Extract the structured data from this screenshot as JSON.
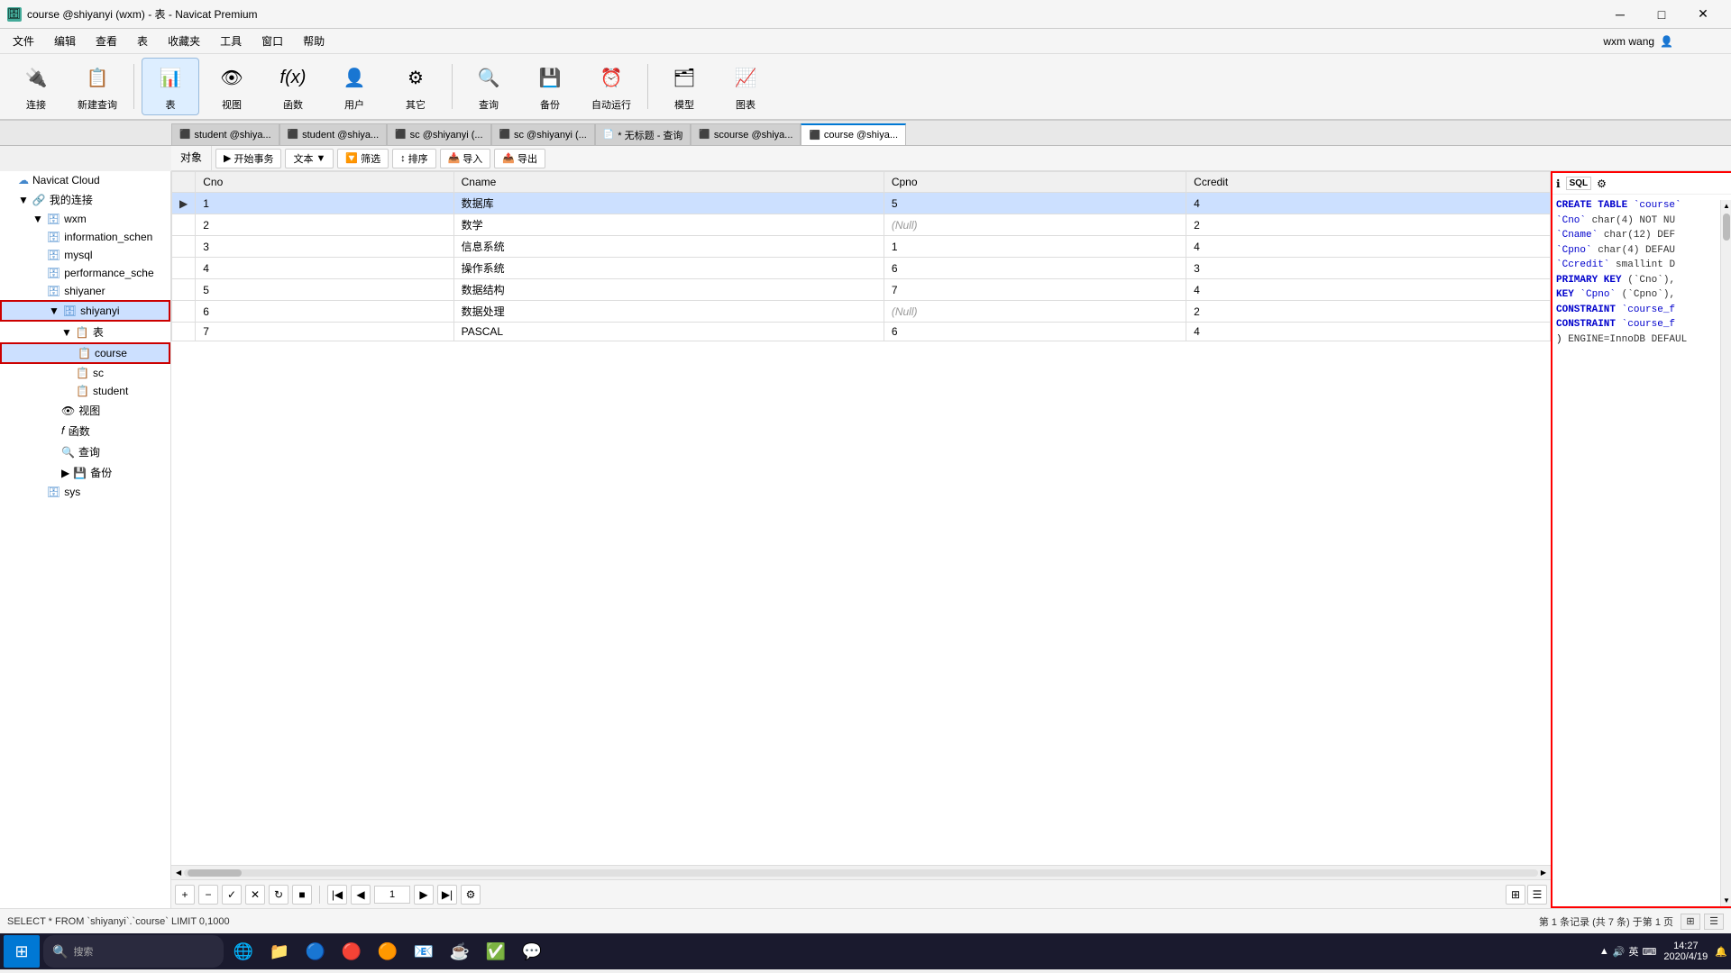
{
  "window": {
    "title": "course @shiyanyi (wxm) - 表 - Navicat Premium",
    "user": "wxm wang",
    "controls": {
      "minimize": "─",
      "maximize": "□",
      "close": "✕"
    }
  },
  "menu": {
    "items": [
      "文件",
      "编辑",
      "查看",
      "表",
      "收藏夹",
      "工具",
      "窗口",
      "帮助"
    ]
  },
  "toolbar": {
    "items": [
      {
        "id": "connect",
        "label": "连接",
        "icon": "🔌"
      },
      {
        "id": "new-query",
        "label": "新建查询",
        "icon": "📄"
      },
      {
        "id": "table",
        "label": "表",
        "icon": "📊",
        "active": true
      },
      {
        "id": "view",
        "label": "视图",
        "icon": "👁"
      },
      {
        "id": "function",
        "label": "函数",
        "icon": "𝑓"
      },
      {
        "id": "user",
        "label": "用户",
        "icon": "👤"
      },
      {
        "id": "other",
        "label": "其它",
        "icon": "⚙"
      },
      {
        "id": "query",
        "label": "查询",
        "icon": "🔍"
      },
      {
        "id": "backup",
        "label": "备份",
        "icon": "💾"
      },
      {
        "id": "auto-run",
        "label": "自动运行",
        "icon": "▶"
      },
      {
        "id": "model",
        "label": "模型",
        "icon": "📐"
      },
      {
        "id": "chart",
        "label": "图表",
        "icon": "📈"
      }
    ]
  },
  "tabs": [
    {
      "label": "student @shiya...",
      "active": false
    },
    {
      "label": "student @shiya...",
      "active": false
    },
    {
      "label": "sc @shiyanyi (...",
      "active": false
    },
    {
      "label": "sc @shiyanyi (...",
      "active": false
    },
    {
      "label": "* 无标题 - 查询",
      "active": false
    },
    {
      "label": "scourse @shiya...",
      "active": false
    },
    {
      "label": "course @shiya...",
      "active": true
    }
  ],
  "object_bar": {
    "items": [
      "对象"
    ],
    "buttons": [
      "开始事务",
      "文本",
      "筛选",
      "排序",
      "导入",
      "导出"
    ]
  },
  "sidebar": {
    "cloud_label": "Navicat Cloud",
    "my_connections": "我的连接",
    "connections": [
      {
        "name": "wxm",
        "expanded": true,
        "databases": [
          {
            "name": "information_schen",
            "expanded": false
          },
          {
            "name": "mysql",
            "expanded": false
          },
          {
            "name": "performance_sche",
            "expanded": false
          },
          {
            "name": "shiyaner",
            "expanded": false
          },
          {
            "name": "shiyanyi",
            "expanded": true,
            "highlighted": true,
            "items": [
              {
                "name": "表",
                "expanded": true,
                "tables": [
                  {
                    "name": "course",
                    "selected": true
                  },
                  {
                    "name": "sc"
                  },
                  {
                    "name": "student"
                  }
                ]
              },
              {
                "name": "视图"
              },
              {
                "name": "函数"
              },
              {
                "name": "查询"
              },
              {
                "name": "备份"
              }
            ]
          },
          {
            "name": "sys",
            "expanded": false
          }
        ]
      }
    ]
  },
  "table": {
    "columns": [
      "Cno",
      "Cname",
      "Cpno",
      "Ccredit"
    ],
    "rows": [
      {
        "cno": "1",
        "cname": "数据库",
        "cpno": "5",
        "ccredit": "4",
        "selected": true
      },
      {
        "cno": "2",
        "cname": "数学",
        "cpno": "(Null)",
        "ccredit": "2"
      },
      {
        "cno": "3",
        "cname": "信息系统",
        "cpno": "1",
        "ccredit": "4"
      },
      {
        "cno": "4",
        "cname": "操作系统",
        "cpno": "6",
        "ccredit": "3"
      },
      {
        "cno": "5",
        "cname": "数据结构",
        "cpno": "7",
        "ccredit": "4"
      },
      {
        "cno": "6",
        "cname": "数据处理",
        "cpno": "(Null)",
        "ccredit": "2"
      },
      {
        "cno": "7",
        "cname": "PASCAL",
        "cpno": "6",
        "ccredit": "4"
      }
    ]
  },
  "sql_preview": {
    "lines": [
      {
        "type": "keyword",
        "text": "CREATE TABLE `course`"
      },
      {
        "type": "text",
        "text": "  `Cno` char(4) NOT NU"
      },
      {
        "type": "text",
        "text": "  `Cname` char(12) DEF"
      },
      {
        "type": "text",
        "text": "  `Cpno` char(4) DEFAU"
      },
      {
        "type": "text",
        "text": "  `Ccredit` smallint D"
      },
      {
        "type": "keyword",
        "text": "  PRIMARY KEY (`Cno`),"
      },
      {
        "type": "text",
        "text": "  KEY `Cpno` (`Cpno`),"
      },
      {
        "type": "constraint",
        "text": "  CONSTRAINT `course_f"
      },
      {
        "type": "constraint",
        "text": "  CONSTRAINT `course_f"
      },
      {
        "type": "text",
        "text": ") ENGINE=InnoDB DEFAUL"
      }
    ]
  },
  "pagination": {
    "current_page": "1",
    "record_info": "第 1 条记录 (共 7 条) 于第 1 页"
  },
  "status_bar": {
    "sql": "SELECT * FROM `shiyanyi`.`course` LIMIT 0,1000"
  },
  "taskbar": {
    "time": "14:27",
    "date": "2020/4/19",
    "apps": [
      "⊞",
      "🌐",
      "📁",
      "🔵",
      "🔴",
      "🟠",
      "📧",
      "☕",
      "✅",
      "💬"
    ]
  }
}
